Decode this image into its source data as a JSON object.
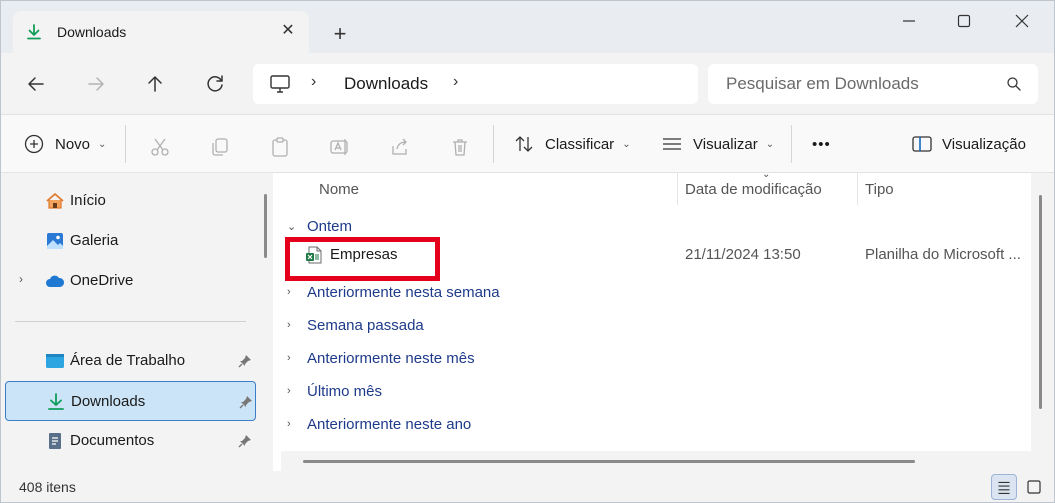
{
  "window": {
    "tab_label": "Downloads",
    "tab_icon": "download-arrow-icon",
    "accent_color": "#0f9d58"
  },
  "address": {
    "location": "Downloads",
    "root_icon": "this-pc-icon",
    "search_placeholder": "Pesquisar em Downloads"
  },
  "commands": {
    "new_label": "Novo",
    "sort_label": "Classificar",
    "view_label": "Visualizar",
    "more_label": "•••",
    "preview_label": "Visualização"
  },
  "sidebar": {
    "items": [
      {
        "label": "Início",
        "icon": "home-icon"
      },
      {
        "label": "Galeria",
        "icon": "gallery-icon"
      },
      {
        "label": "OneDrive",
        "icon": "cloud-icon"
      },
      {
        "label": "Área de Trabalho",
        "icon": "desktop-icon",
        "pinned": true
      },
      {
        "label": "Downloads",
        "icon": "download-arrow-icon",
        "pinned": true,
        "selected": true
      },
      {
        "label": "Documentos",
        "icon": "document-icon",
        "pinned": true
      }
    ]
  },
  "columns": {
    "name": "Nome",
    "modified": "Data de modificação",
    "type": "Tipo"
  },
  "groups": [
    {
      "label": "Ontem",
      "expanded": true
    },
    {
      "label": "Anteriormente nesta semana",
      "expanded": false
    },
    {
      "label": "Semana passada",
      "expanded": false
    },
    {
      "label": "Anteriormente neste mês",
      "expanded": false
    },
    {
      "label": "Último mês",
      "expanded": false
    },
    {
      "label": "Anteriormente neste ano",
      "expanded": false
    }
  ],
  "files": [
    {
      "name": "Empresas",
      "modified": "21/11/2024 13:50",
      "type": "Planilha do Microsoft ...",
      "icon": "excel-file-icon"
    }
  ],
  "status": {
    "item_count": "408 itens"
  },
  "highlight_color": "#e4001b"
}
